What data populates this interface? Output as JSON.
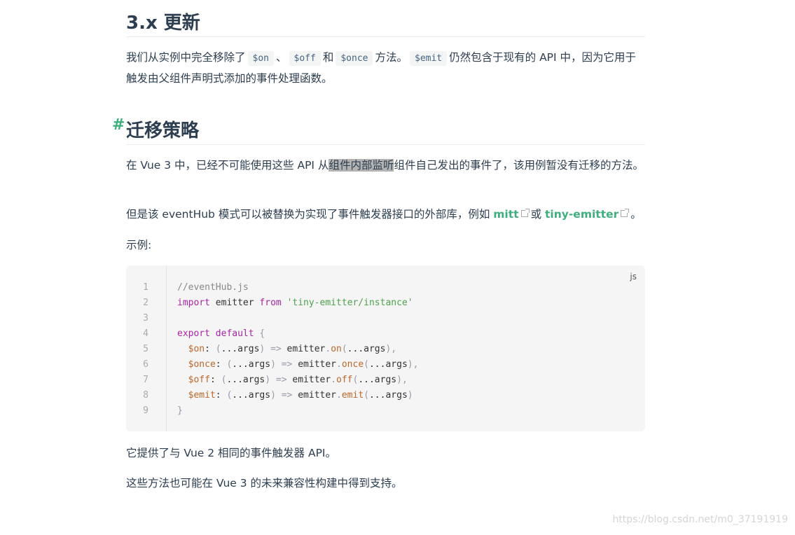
{
  "section_update": {
    "title": "3.x 更新",
    "para_a": "我们从实例中完全移除了",
    "code_on": "$on",
    "sep1": "、",
    "code_off": "$off",
    "and": "和",
    "code_once": "$once",
    "para_b": "方法。",
    "code_emit": "$emit",
    "para_c": "仍然包含于现有的 API 中，因为它用于触发由父组件声明式添加的事件处理函数。"
  },
  "section_migrate": {
    "anchor": "#",
    "title": "迁移策略",
    "p1_a": "在 Vue 3 中，已经不可能使用这些 API 从",
    "p1_highlight": "组件内部监听",
    "p1_b": "组件自己发出的事件了，该用例暂没有迁移的方法。",
    "p2_a": "但是该 eventHub 模式可以被替换为实现了事件触发器接口的外部库，例如",
    "link_mitt": "mitt",
    "p2_or": "或",
    "link_tiny": "tiny-emitter",
    "p2_end": "。",
    "p3": "示例:",
    "p4": "它提供了与 Vue 2 相同的事件触发器 API。",
    "p5": "这些方法也可能在 Vue 3 的未来兼容性构建中得到支持。"
  },
  "code": {
    "lang": "js",
    "lines": [
      "//eventHub.js",
      "import emitter from 'tiny-emitter/instance'",
      "",
      "export default {",
      "  $on: (...args) => emitter.on(...args),",
      "  $once: (...args) => emitter.once(...args),",
      "  $off: (...args) => emitter.off(...args),",
      "  $emit: (...args) => emitter.emit(...args)",
      "}"
    ],
    "line_numbers": [
      "1",
      "2",
      "3",
      "4",
      "5",
      "6",
      "7",
      "8",
      "9"
    ]
  },
  "watermark": "https://blog.csdn.net/m0_37191919",
  "colors": {
    "heading": "#2c3e50",
    "accent": "#3eaf7c",
    "code_bg": "#f5f5f5",
    "keyword": "#a626a4",
    "string": "#50a14f",
    "property": "#c0662a"
  }
}
